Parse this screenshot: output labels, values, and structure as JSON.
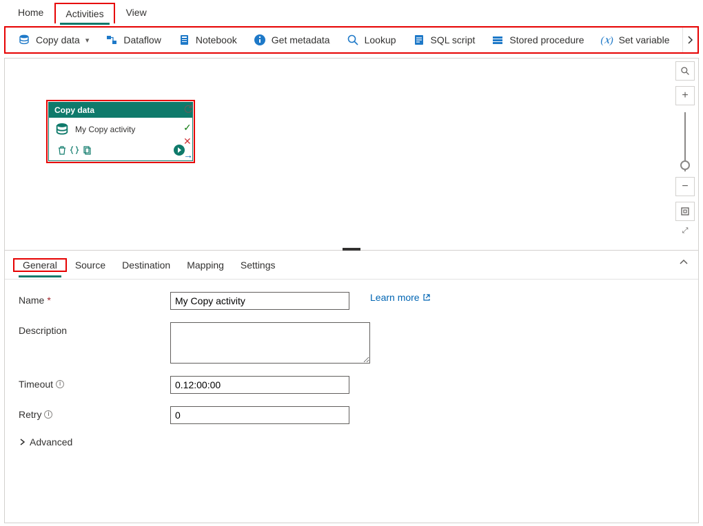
{
  "top_tabs": {
    "home": "Home",
    "activities": "Activities",
    "view": "View"
  },
  "toolbar": {
    "copy_data": "Copy data",
    "dataflow": "Dataflow",
    "notebook": "Notebook",
    "get_metadata": "Get metadata",
    "lookup": "Lookup",
    "sql_script": "SQL script",
    "stored_procedure": "Stored procedure",
    "set_variable": "Set variable"
  },
  "activity": {
    "type_label": "Copy data",
    "name": "My Copy activity"
  },
  "detail_tabs": {
    "general": "General",
    "source": "Source",
    "destination": "Destination",
    "mapping": "Mapping",
    "settings": "Settings"
  },
  "form": {
    "name_label": "Name",
    "name_value": "My Copy activity",
    "description_label": "Description",
    "description_value": "",
    "timeout_label": "Timeout",
    "timeout_value": "0.12:00:00",
    "retry_label": "Retry",
    "retry_value": "0",
    "advanced_label": "Advanced",
    "learn_more": "Learn more"
  }
}
